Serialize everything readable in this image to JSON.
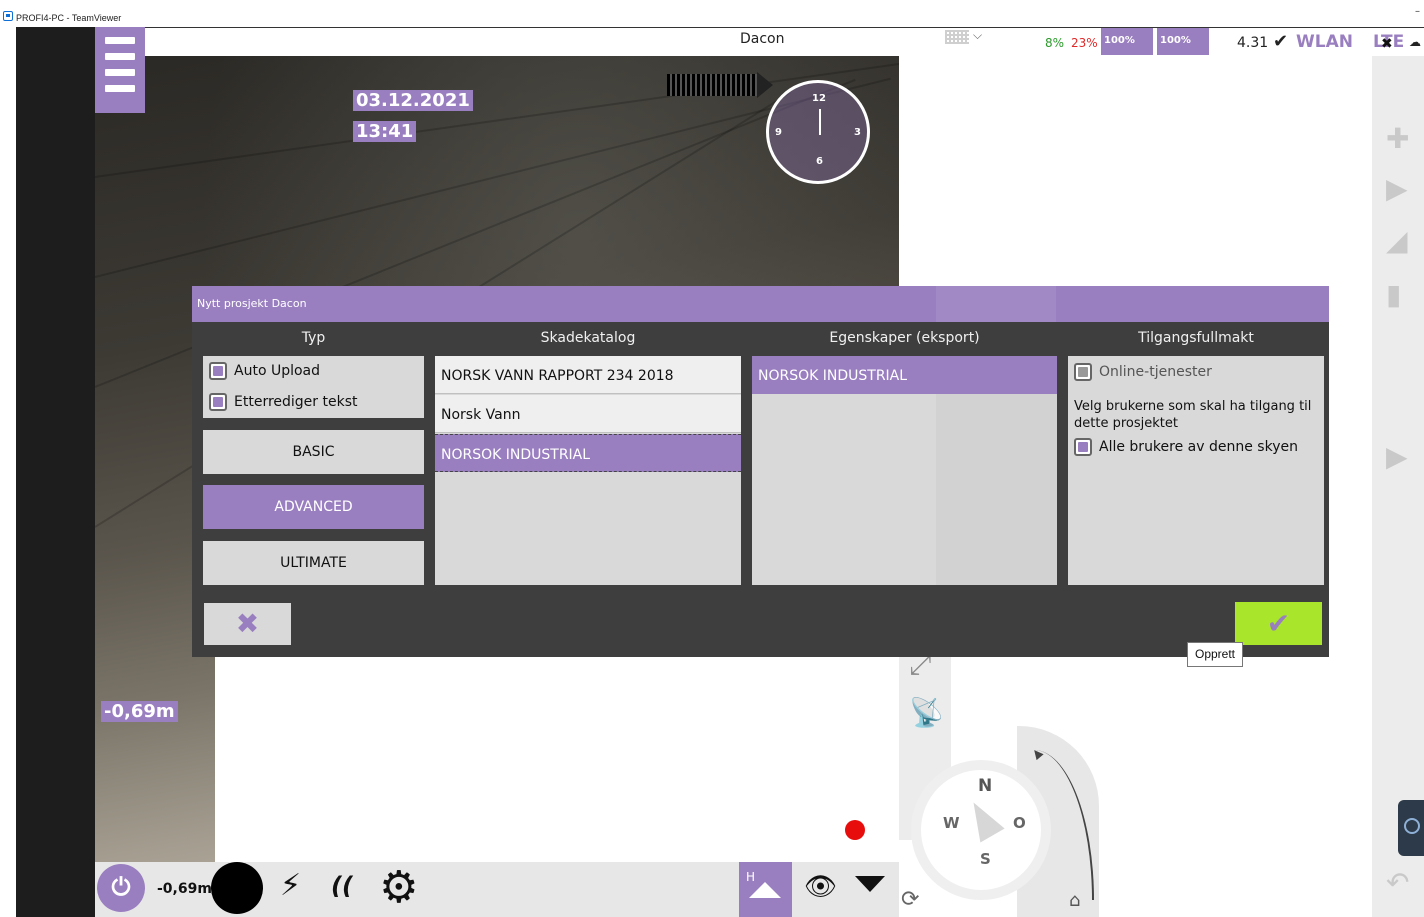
{
  "window": {
    "title": "PROFI4-PC - TeamViewer",
    "minimize": "–"
  },
  "header": {
    "app_title": "Dacon",
    "chevron": "⌵",
    "cpu_green": "8%",
    "cpu_red": "23%",
    "badge1": "100%",
    "badge2": "100%",
    "version": "4.31",
    "check": "✔",
    "wlan": "WLAN",
    "lte": "LTE",
    "lte_x": "✖",
    "cloud": "☁"
  },
  "camera": {
    "date": "03.12.2021",
    "time": "13:41",
    "depth": "-0,69m",
    "clock": {
      "n12": "12",
      "n3": "3",
      "n6": "6",
      "n9": "9"
    }
  },
  "dialog": {
    "title": "Nytt prosjekt Dacon",
    "columns": {
      "typ": "Typ",
      "skadekatalog": "Skadekatalog",
      "egenskaper": "Egenskaper (eksport)",
      "tilgang": "Tilgangsfullmakt"
    },
    "typ": {
      "auto_upload": "Auto Upload",
      "etterrediger": "Etterrediger tekst",
      "buttons": [
        "BASIC",
        "ADVANCED",
        "ULTIMATE"
      ],
      "selected": "ADVANCED"
    },
    "skadekatalog": [
      "NORSK VANN RAPPORT 234 2018",
      "Norsk Vann",
      "NORSOK INDUSTRIAL"
    ],
    "skadekatalog_selected": "NORSOK INDUSTRIAL",
    "egenskaper": [
      "NORSOK INDUSTRIAL"
    ],
    "tilgang": {
      "online": "Online-tjenester",
      "description": "Velg brukerne som skal ha tilgang til dette prosjektet",
      "all_users": "Alle brukere av denne skyen"
    },
    "cancel_icon": "✖",
    "ok_icon": "✔",
    "ok_tooltip": "Opprett"
  },
  "compass": {
    "n": "N",
    "w": "W",
    "o": "O",
    "s": "S"
  },
  "bottom": {
    "depth": "-0,69m",
    "power_icon": "⏻",
    "bolt_icon": "⚡",
    "signal_icon": "((",
    "gear_icon": "⚙",
    "h_label": "H",
    "eye_icon": "👁",
    "refresh_icon": "⟳",
    "home_icon": "⌂"
  },
  "colors": {
    "accent": "#9a7fc0",
    "confirm": "#a8e52b",
    "dialog_bg": "#3e3e3e",
    "record": "#e80d0d"
  }
}
